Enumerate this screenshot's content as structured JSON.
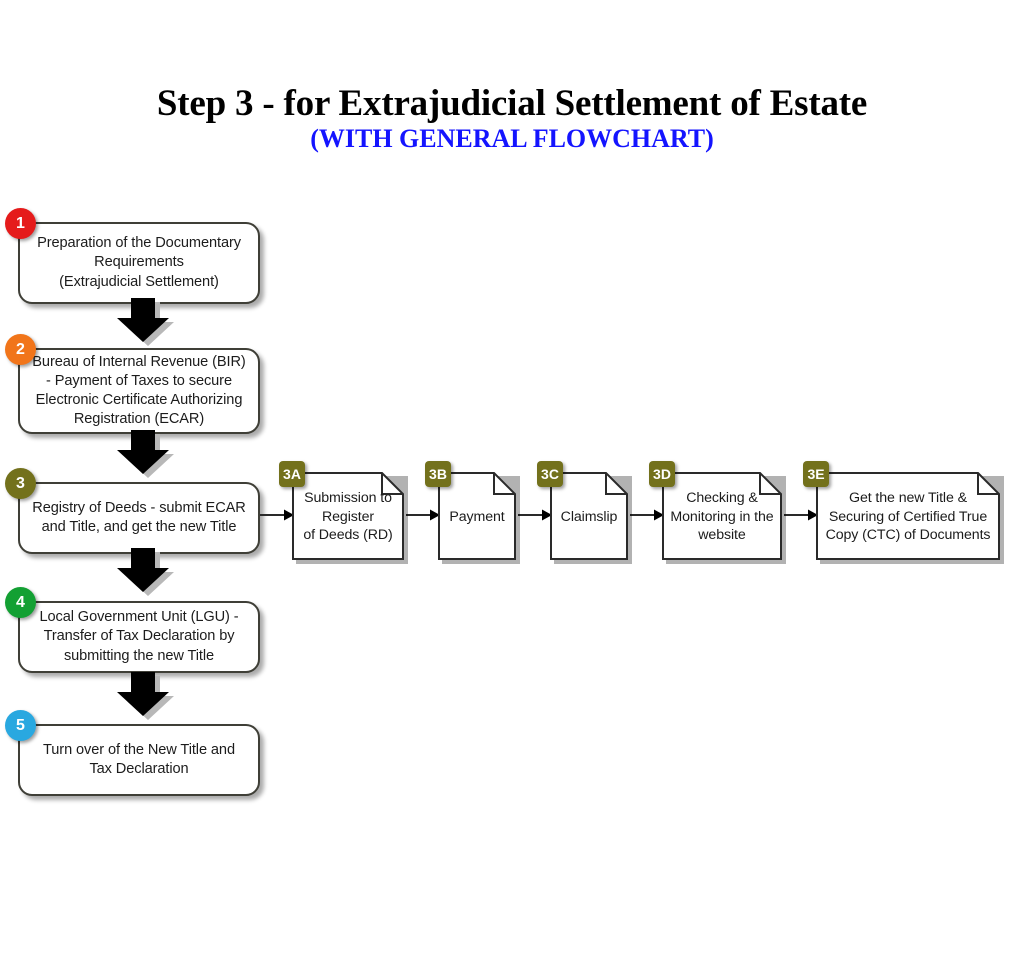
{
  "title": {
    "main": "Step 3 - for Extrajudicial Settlement of Estate",
    "sub": "(WITH GENERAL FLOWCHART)",
    "sub_color": "#1414ff"
  },
  "main_steps": [
    {
      "badge": "1",
      "badge_color": "#e51b1b",
      "text": "Preparation of the Documentary\nRequirements\n(Extrajudicial Settlement)"
    },
    {
      "badge": "2",
      "badge_color": "#f1751a",
      "text": "Bureau of Internal Revenue (BIR)\n- Payment of Taxes to secure\nElectronic Certificate Authorizing\nRegistration (ECAR)"
    },
    {
      "badge": "3",
      "badge_color": "#73711c",
      "text": "Registry of Deeds - submit ECAR\nand Title, and get the new Title"
    },
    {
      "badge": "4",
      "badge_color": "#13a033",
      "text": "Local Government Unit (LGU) -\nTransfer of Tax Declaration by\nsubmitting the new Title"
    },
    {
      "badge": "5",
      "badge_color": "#29a8e0",
      "text": "Turn over of the New Title and\nTax Declaration"
    }
  ],
  "sub_steps": [
    {
      "badge": "3A",
      "badge_color": "#73711c",
      "text": "Submission to\nRegister\nof Deeds (RD)"
    },
    {
      "badge": "3B",
      "badge_color": "#73711c",
      "text": "Payment"
    },
    {
      "badge": "3C",
      "badge_color": "#73711c",
      "text": "Claimslip"
    },
    {
      "badge": "3D",
      "badge_color": "#73711c",
      "text": "Checking &\nMonitoring in the\nwebsite"
    },
    {
      "badge": "3E",
      "badge_color": "#73711c",
      "text": "Get the new Title &\nSecuring of Certified True\nCopy (CTC) of Documents"
    }
  ],
  "colors": {
    "box_border": "#3f3f37",
    "doc_border": "#2a2a2a",
    "arrow_fill": "#000000",
    "background": "#ffffff"
  }
}
